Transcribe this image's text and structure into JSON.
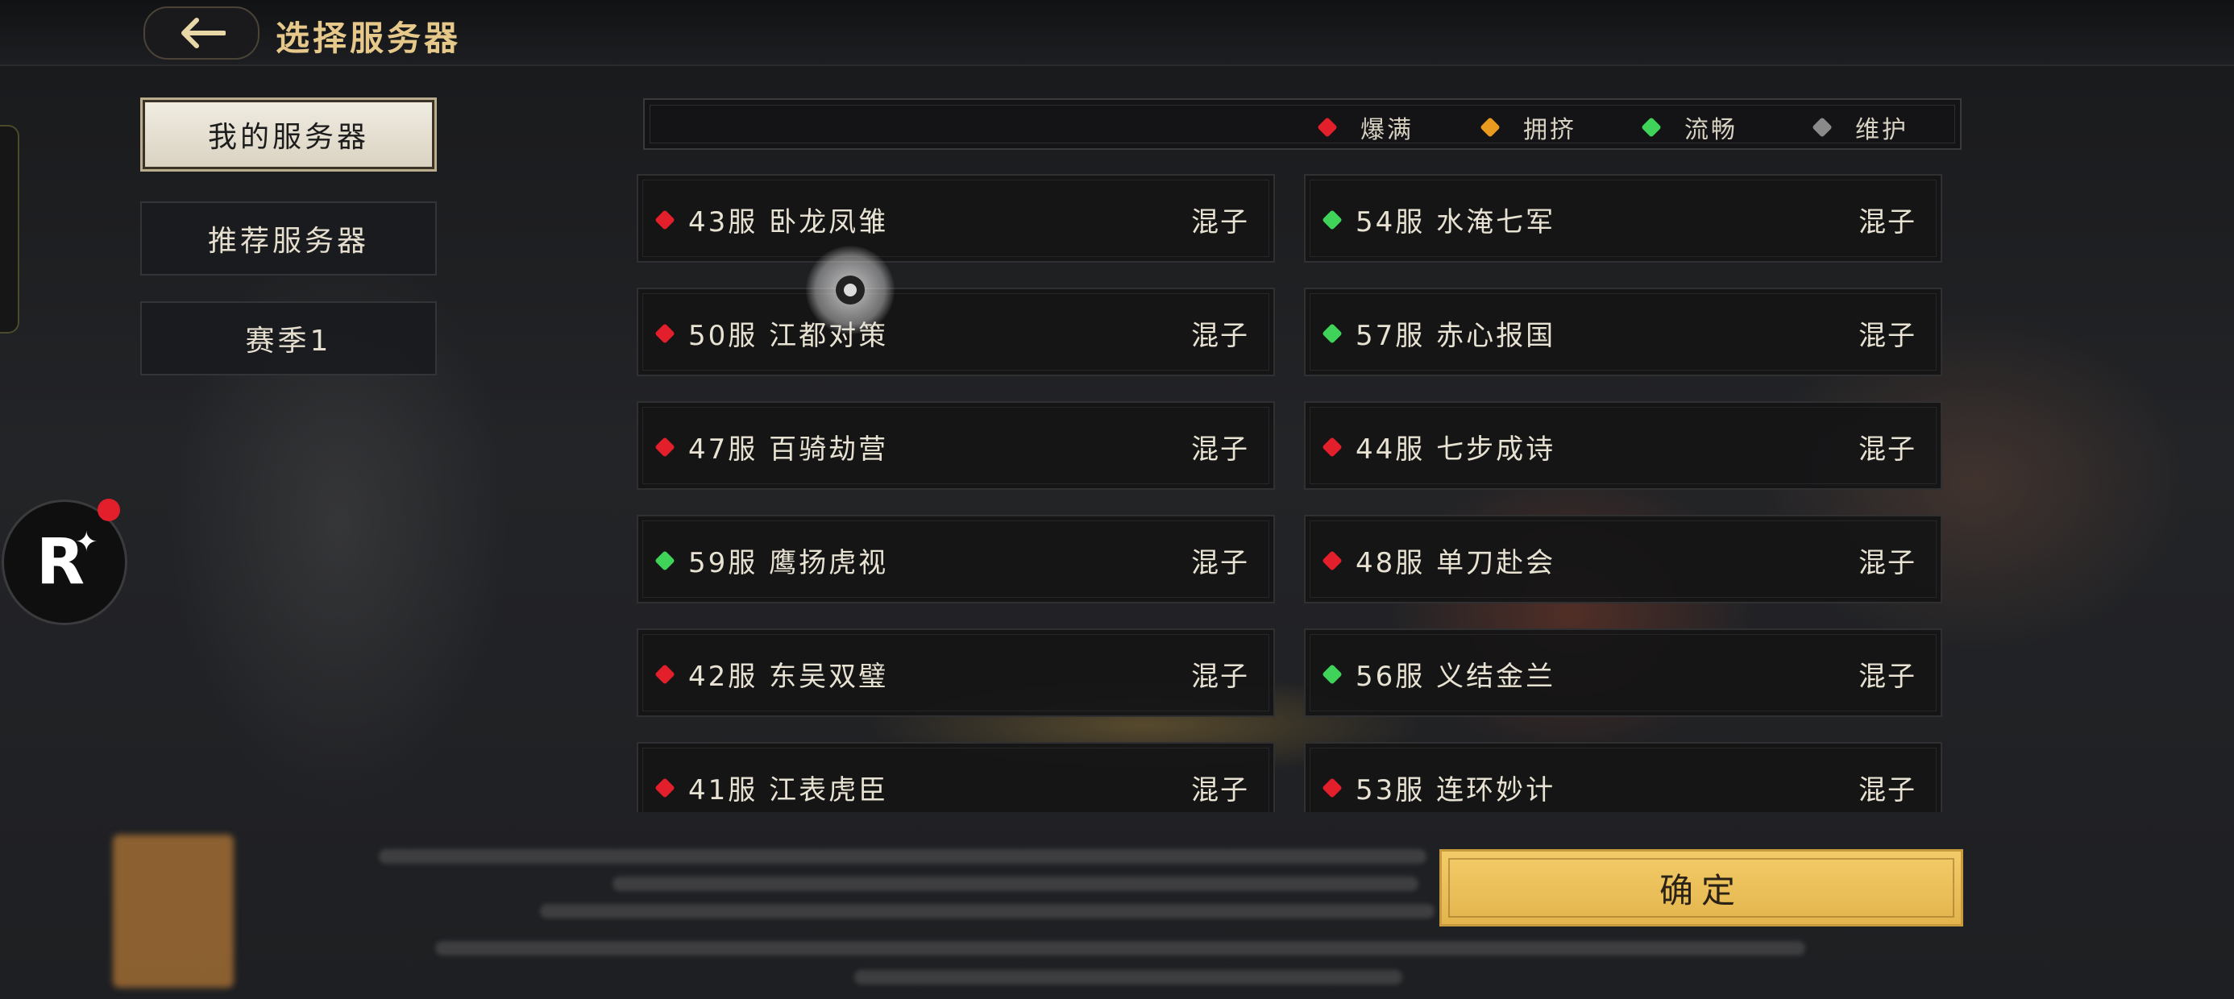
{
  "header": {
    "title": "选择服务器"
  },
  "tabs": [
    {
      "label": "我的服务器",
      "active": true
    },
    {
      "label": "推荐服务器",
      "active": false
    },
    {
      "label": "赛季1",
      "active": false
    }
  ],
  "legend": [
    {
      "label": "爆满",
      "color": "#e21f2a"
    },
    {
      "label": "拥挤",
      "color": "#e99a1f"
    },
    {
      "label": "流畅",
      "color": "#3fd35a"
    },
    {
      "label": "维护",
      "color": "#8a8a8a"
    }
  ],
  "servers": [
    {
      "name": "43服  卧龙凤雏",
      "tag": "混子",
      "status_color": "#e21f2a"
    },
    {
      "name": "54服  水淹七军",
      "tag": "混子",
      "status_color": "#3fd35a"
    },
    {
      "name": "50服  江都对策",
      "tag": "混子",
      "status_color": "#e21f2a"
    },
    {
      "name": "57服  赤心报国",
      "tag": "混子",
      "status_color": "#3fd35a"
    },
    {
      "name": "47服  百骑劫营",
      "tag": "混子",
      "status_color": "#e21f2a"
    },
    {
      "name": "44服  七步成诗",
      "tag": "混子",
      "status_color": "#e21f2a"
    },
    {
      "name": "59服  鹰扬虎视",
      "tag": "混子",
      "status_color": "#3fd35a"
    },
    {
      "name": "48服  单刀赴会",
      "tag": "混子",
      "status_color": "#e21f2a"
    },
    {
      "name": "42服  东吴双璧",
      "tag": "混子",
      "status_color": "#e21f2a"
    },
    {
      "name": "56服  义结金兰",
      "tag": "混子",
      "status_color": "#3fd35a"
    },
    {
      "name": "41服  江表虎臣",
      "tag": "混子",
      "status_color": "#e21f2a"
    },
    {
      "name": "53服  连环妙计",
      "tag": "混子",
      "status_color": "#e21f2a"
    }
  ],
  "confirm": {
    "label": "确定"
  },
  "badge": {
    "letter": "R"
  }
}
